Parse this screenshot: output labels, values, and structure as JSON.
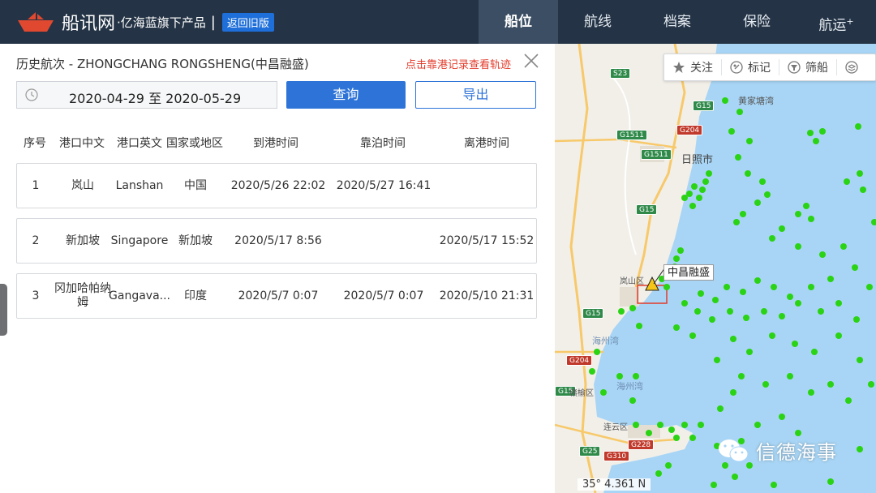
{
  "header": {
    "logo_name": "船讯网",
    "logo_sub": "·亿海蓝旗下产品",
    "separator": "|",
    "old_version": "返回旧版",
    "nav": [
      {
        "label": "船位",
        "active": true
      },
      {
        "label": "航线",
        "active": false
      },
      {
        "label": "档案",
        "active": false
      },
      {
        "label": "保险",
        "active": false
      },
      {
        "label": "航运",
        "active": false,
        "sup": "+"
      }
    ]
  },
  "panel": {
    "title": "历史航次 - ZHONGCHANG RONGSHENG(中昌融盛)",
    "track_link": "点击靠港记录查看轨迹",
    "date_range": "2020-04-29 至 2020-05-29",
    "query_label": "查询",
    "export_label": "导出",
    "columns": [
      "序号",
      "港口中文",
      "港口英文",
      "国家或地区",
      "到港时间",
      "靠泊时间",
      "离港时间"
    ],
    "rows": [
      {
        "no": "1",
        "port_cn": "岚山",
        "port_en": "Lanshan",
        "country": "中国",
        "arrive": "2020/5/26 22:02",
        "berth": "2020/5/27 16:41",
        "depart": ""
      },
      {
        "no": "2",
        "port_cn": "新加坡",
        "port_en": "Singapore",
        "country": "新加坡",
        "arrive": "2020/5/17 8:56",
        "berth": "",
        "depart": "2020/5/17 15:52"
      },
      {
        "no": "3",
        "port_cn": "冈加哈帕纳姆",
        "port_en": "Gangava...",
        "country": "印度",
        "arrive": "2020/5/7 0:07",
        "berth": "2020/5/7 0:07",
        "depart": "2020/5/10 21:31"
      }
    ]
  },
  "map": {
    "tools": [
      "关注",
      "标记",
      "筛船"
    ],
    "ship_label": "中昌融盛",
    "coordinate": "35° 4.361 N",
    "watermark": "信德海事",
    "places": [
      "日照市",
      "黄家塘湾",
      "岚山区",
      "海州湾",
      "海州湾",
      "赣榆区",
      "连云区"
    ],
    "road_signs": [
      "S23",
      "G15",
      "G1511",
      "G204",
      "G1511",
      "G15",
      "G15",
      "G204",
      "G15",
      "G25",
      "G228",
      "G310"
    ],
    "colors": {
      "sea": "#a8d5f5",
      "land": "#f2efe9",
      "ship": "#2ad313",
      "selected_ship": "#f5c518"
    }
  },
  "colors": {
    "topbar": "#243345",
    "accent": "#2e74d8",
    "link_red": "#e23b2a"
  }
}
